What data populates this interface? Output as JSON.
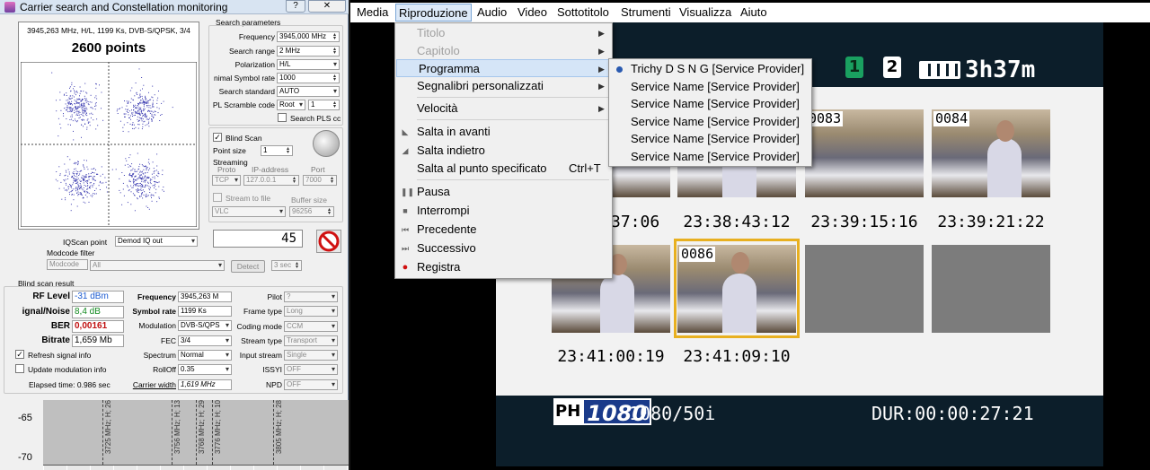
{
  "carrier": {
    "title": "Carrier search and Constellation monitoring",
    "help_btn": "?",
    "close_btn": "✕",
    "plot_header": "3945,263 MHz, H/L, 1199 Ks, DVB-S/QPSK, 3/4",
    "points": "2600 points",
    "search_params_title": "Search parameters",
    "frequency_label": "Frequency",
    "frequency_value": "3945,000 MHz",
    "search_range_label": "Search range",
    "search_range_value": "2 MHz",
    "polarization_label": "Polarization",
    "polarization_value": "H/L",
    "min_sr_label": "nimal Symbol rate",
    "min_sr_value": "1000",
    "search_std_label": "Search standard",
    "search_std_value": "AUTO",
    "pl_scramble_label": "PL Scramble code",
    "pl_scramble_value": "Root",
    "pl_scramble_num": "1",
    "search_pls_label": "Search PLS cc",
    "blind_scan_label": "Blind Scan",
    "point_size_label": "Point size",
    "point_size_value": "1",
    "streaming_label": "Streaming",
    "proto_label": "Proto",
    "ip_label": "IP-address",
    "port_label": "Port",
    "proto_value": "TCP",
    "ip_value": "127.0.0.1",
    "port_value": "7000",
    "stream_to_file_label": "Stream to file",
    "buffer_size_label": "Buffer size",
    "player_value": "VLC",
    "buffer_value": "96256",
    "counter_value": "45",
    "iqscan_label": "IQScan point",
    "iqscan_value": "Demod IQ out",
    "modcode_filter_label": "Modcode filter",
    "modcode_label": "Modcode",
    "modcode_value": "All",
    "detect_label": "Detect",
    "sec_value": "3 sec",
    "result_title": "Blind scan result",
    "rf_level_label": "RF Level",
    "rf_level_value": "-31 dBm",
    "sn_label": "ignal/Noise",
    "sn_value": "8,4 dB",
    "ber_label": "BER",
    "ber_value": "0,00161",
    "bitrate_label": "Bitrate",
    "bitrate_value": "1,659 Mb",
    "res_freq_label": "Frequency",
    "res_freq_value": "3945,263 M",
    "res_sr_label": "Symbol rate",
    "res_sr_value": "1199 Ks",
    "modulation_label": "Modulation",
    "modulation_value": "DVB-S/QPS",
    "fec_label": "FEC",
    "fec_value": "3/4",
    "spectrum_label": "Spectrum",
    "spectrum_value": "Normal",
    "rolloff_label": "RollOff",
    "rolloff_value": "0.35",
    "carrier_width_label": "Carrier width",
    "carrier_width_value": "1,619 MHz",
    "pilot_label": "Pilot",
    "pilot_value": "?",
    "frame_type_label": "Frame type",
    "frame_type_value": "Long",
    "coding_mode_label": "Coding mode",
    "coding_mode_value": "CCM",
    "stream_type_label": "Stream type",
    "stream_type_value": "Transport",
    "input_stream_label": "Input stream",
    "input_stream_value": "Single",
    "issyi_label": "ISSYI",
    "issyi_value": "OFF",
    "npd_label": "NPD",
    "npd_value": "OFF",
    "refresh_label": "Refresh signal info",
    "update_mod_label": "Update modulation info",
    "elapsed_label": "Elapsed time: 0.986 sec"
  },
  "spectrum": {
    "y_labels": [
      "-65",
      "-70"
    ],
    "markers": [
      "3725 MHz; H; 26",
      "3756 MHz; H; 13",
      "3768 MHz; H; 29",
      "3776 MHz; H; 10",
      "3805 MHz; H; 28"
    ]
  },
  "vlc": {
    "menu": [
      "Media",
      "Riproduzione",
      "Audio",
      "Video",
      "Sottotitolo",
      "Strumenti",
      "Visualizza",
      "Aiuto"
    ],
    "playback_menu": {
      "titolo": "Titolo",
      "capitolo": "Capitolo",
      "programma": "Programma",
      "segnalibri": "Segnalibri personalizzati",
      "velocita": "Velocità",
      "salta_avanti": "Salta in avanti",
      "salta_indietro": "Salta indietro",
      "salta_punto": "Salta al punto specificato",
      "salta_punto_sc": "Ctrl+T",
      "pausa": "Pausa",
      "interrompi": "Interrompi",
      "precedente": "Precedente",
      "successivo": "Successivo",
      "registra": "Registra"
    },
    "program_submenu": [
      "Trichy D S N G [Service Provider]",
      "Service Name [Service Provider]",
      "Service Name [Service Provider]",
      "Service Name [Service Provider]",
      "Service Name [Service Provider]",
      "Service Name [Service Provider]"
    ],
    "colors": {
      "selection_frame": "#e8b020",
      "record_dot": "#d01010",
      "accent": "#2a5ab0"
    }
  },
  "video": {
    "badge1": "1",
    "badge2": "2",
    "battery_time": "3h37m",
    "thumb_numbers": [
      "0083",
      "0084",
      "0086"
    ],
    "timecodes": [
      "37:06",
      "23:38:43:12",
      "23:39:15:16",
      "23:39:21:22",
      "23:41:00:19",
      "23:41:09:10"
    ],
    "ph_label": "PH",
    "res_1080": "1080",
    "format": "1080/50i",
    "duration": "DUR:00:00:27:21"
  }
}
